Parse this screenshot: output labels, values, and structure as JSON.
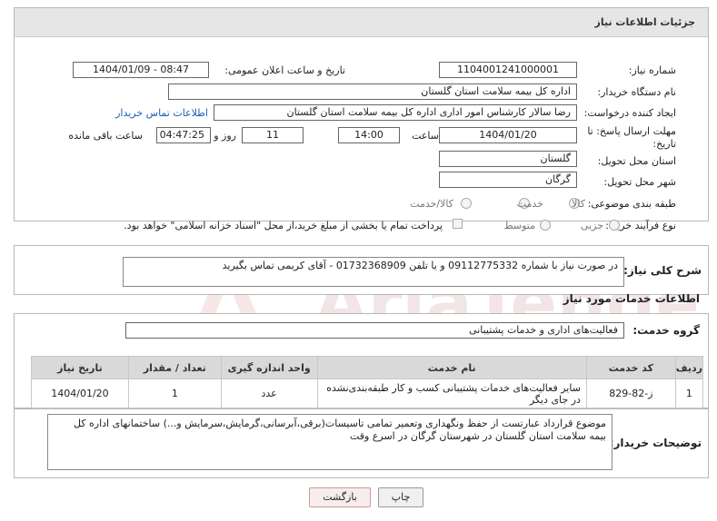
{
  "header": {
    "title": "جزئیات اطلاعات نیاز"
  },
  "fields": {
    "need_number_label": "شماره نیاز:",
    "need_number": "1104001241000001",
    "announce_label": "تاریخ و ساعت اعلان عمومی:",
    "announce_value": "1404/01/09 - 08:47",
    "buyer_org_label": "نام دستگاه خریدار:",
    "buyer_org": "اداره کل بیمه سلامت استان گلستان",
    "creator_label": "ایجاد کننده درخواست:",
    "creator": "رضا سالار کارشناس امور اداری اداره کل بیمه سلامت استان گلستان",
    "contact_link": "اطلاعات تماس خریدار",
    "deadline_label": "مهلت ارسال پاسخ: تا تاریخ:",
    "deadline_date": "1404/01/20",
    "time_label": "ساعت",
    "deadline_time": "14:00",
    "days_value": "11",
    "days_label": "روز و",
    "remaining_time": "04:47:25",
    "remaining_label": "ساعت باقی مانده",
    "province_label": "استان محل تحویل:",
    "province": "گلستان",
    "city_label": "شهر محل تحویل:",
    "city": "گرگان",
    "category_label": "طبقه بندی موضوعی:",
    "category_options": [
      "کالا",
      "خدمت",
      "کالا/خدمت"
    ],
    "process_label": "نوع فرآیند خرید :",
    "process_options": [
      "جزیی",
      "متوسط"
    ],
    "payment_note": "پرداخت تمام یا بخشی از مبلغ خرید،از محل \"اسناد خزانه اسلامی\" خواهد بود."
  },
  "summary": {
    "label": "شرح کلی نیاز:",
    "text": "در صورت نیاز با شماره 09112775332 و یا تلفن 01732368909  -  آقای کریمی تماس بگیرید"
  },
  "services": {
    "section_title": "اطلاعات خدمات مورد نیاز",
    "group_label": "گروه خدمت:",
    "group_value": "فعالیت‌های اداری و خدمات پشتیبانی",
    "columns": [
      "ردیف",
      "کد خدمت",
      "نام خدمت",
      "واحد اندازه گیری",
      "تعداد / مقدار",
      "تاریخ نیاز"
    ],
    "rows": [
      {
        "row": "1",
        "code": "ز-82-829",
        "name": "سایر فعالیت‌های خدمات پشتیبانی کسب و کار طبقه‌بندی‌نشده در جای دیگر",
        "unit": "عدد",
        "qty": "1",
        "date": "1404/01/20"
      }
    ]
  },
  "buyer_notes": {
    "label": "توضیحات خریدار:",
    "text": "موضوع قرارداد عبارتست از حفظ ونگهداری وتعمیر تمامی تاسیسات(برقی،آبرسانی،گرمایش،سرمایش و...) ساختمانهای اداره کل بیمه سلامت استان گلستان در شهرستان گرگان در اسرع وقت"
  },
  "buttons": {
    "print": "چاپ",
    "back": "بازگشت"
  },
  "colors": {
    "watermark": "#e8c4c4",
    "link": "#1a5fb4",
    "back_border": "#c99"
  }
}
